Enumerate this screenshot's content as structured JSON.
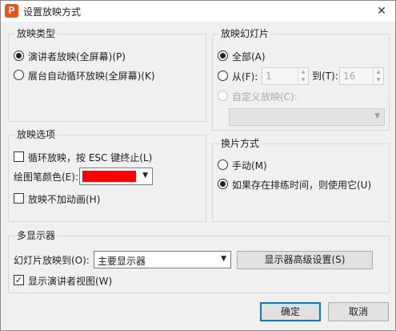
{
  "window": {
    "title": "设置放映方式",
    "app_icon_letter": "P",
    "close_glyph": "✕"
  },
  "show_type": {
    "legend": "放映类型",
    "presenter": "演讲者放映(全屏幕)(P)",
    "kiosk": "展台自动循环放映(全屏幕)(K)",
    "selected": "presenter"
  },
  "show_slides": {
    "legend": "放映幻灯片",
    "all": "全部(A)",
    "from": "从(F):",
    "from_value": "1",
    "to": "到(T):",
    "to_value": "16",
    "custom": "自定义放映(C):",
    "custom_value": "",
    "selected": "all"
  },
  "show_options": {
    "legend": "放映选项",
    "loop": "循环放映，按 ESC 键终止(L)",
    "loop_checked": false,
    "pen_color_label": "绘图笔颜色(E):",
    "pen_color": "#ff0000",
    "no_animation": "放映不加动画(H)",
    "no_animation_checked": false
  },
  "advance": {
    "legend": "换片方式",
    "manual": "手动(M)",
    "timings": "如果存在排练时间，则使用它(U)",
    "selected": "timings"
  },
  "multi_monitor": {
    "legend": "多显示器",
    "show_on_label": "幻灯片放映到(O):",
    "show_on_value": "主要显示器",
    "advanced_button": "显示器高级设置(S)",
    "presenter_view": "显示演讲者视图(W)",
    "presenter_view_checked": true,
    "check_glyph": "✓"
  },
  "buttons": {
    "ok": "确定",
    "cancel": "取消"
  }
}
